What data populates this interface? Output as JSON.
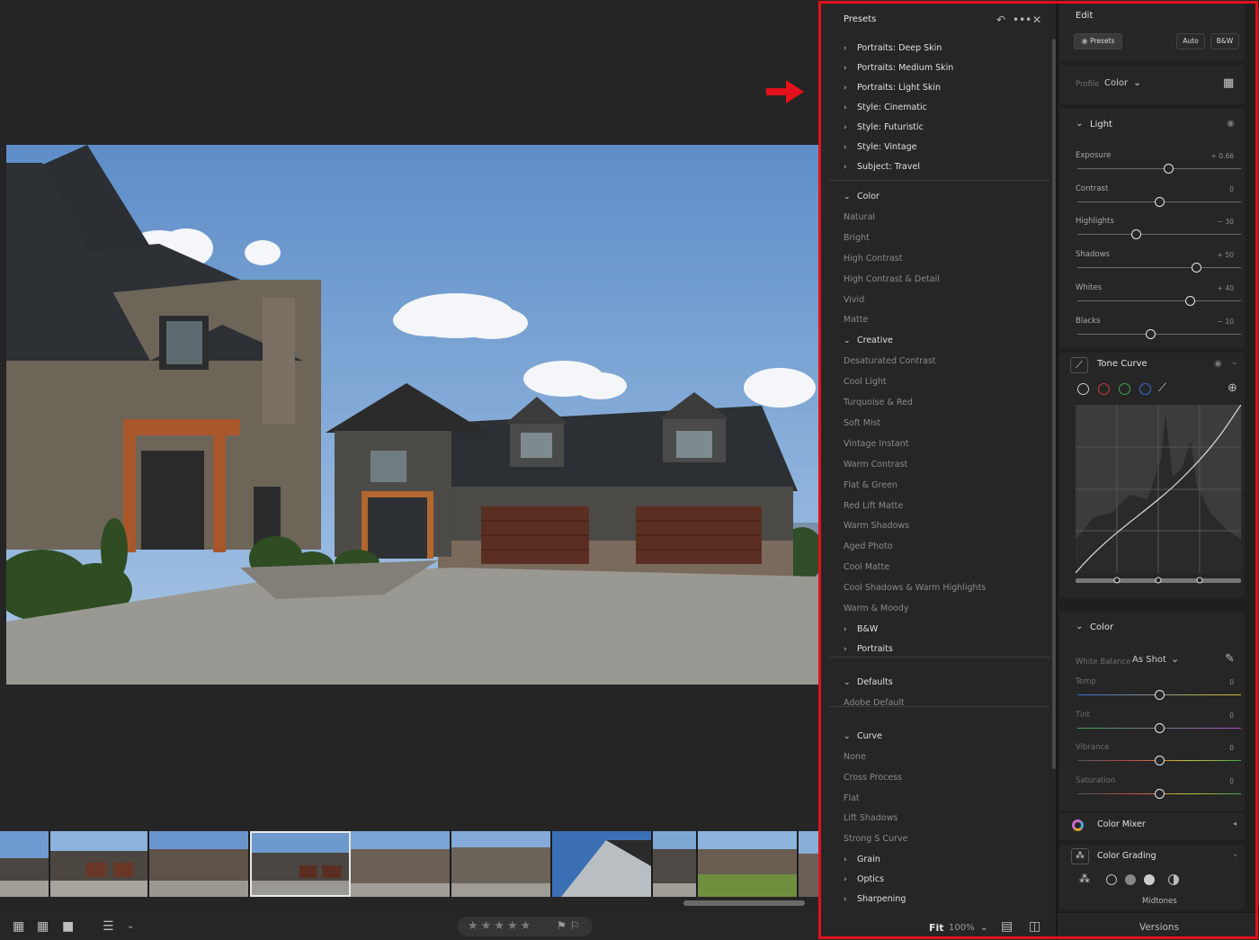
{
  "presets": {
    "title": "Presets",
    "groups_top": [
      {
        "label": "Portraits: Deep Skin"
      },
      {
        "label": "Portraits: Medium Skin"
      },
      {
        "label": "Portraits: Light Skin"
      },
      {
        "label": "Style: Cinematic"
      },
      {
        "label": "Style: Futuristic"
      },
      {
        "label": "Style: Vintage"
      },
      {
        "label": "Subject: Travel"
      }
    ],
    "color_group": {
      "label": "Color",
      "items": [
        "Natural",
        "Bright",
        "High Contrast",
        "High Contrast & Detail",
        "Vivid",
        "Matte"
      ]
    },
    "creative_group": {
      "label": "Creative",
      "items": [
        "Desaturated Contrast",
        "Cool Light",
        "Turquoise & Red",
        "Soft Mist",
        "Vintage Instant",
        "Warm Contrast",
        "Flat & Green",
        "Red Lift Matte",
        "Warm Shadows",
        "Aged Photo",
        "Cool Matte",
        "Cool Shadows & Warm Highlights",
        "Warm & Moody"
      ]
    },
    "bw_group": {
      "label": "B&W"
    },
    "portraits_group": {
      "label": "Portraits"
    },
    "defaults_group": {
      "label": "Defaults",
      "items": [
        "Adobe Default"
      ]
    },
    "curve_group": {
      "label": "Curve",
      "items": [
        "None",
        "Cross Process",
        "Flat",
        "Lift Shadows",
        "Strong S Curve"
      ]
    },
    "grain_group": {
      "label": "Grain"
    },
    "optics_group": {
      "label": "Optics"
    },
    "sharpening_group": {
      "label": "Sharpening"
    },
    "footer": {
      "fit": "Fit",
      "zoom": "100%"
    }
  },
  "edit": {
    "title": "Edit",
    "presets_button": "Presets",
    "auto_button": "Auto",
    "bw_button": "B&W",
    "profile_label": "Profile",
    "profile_value": "Color",
    "light": {
      "label": "Light",
      "sliders": [
        {
          "name": "Exposure",
          "value": "+ 0.66",
          "level": 0.56
        },
        {
          "name": "Contrast",
          "value": "0",
          "level": 0.5
        },
        {
          "name": "Highlights",
          "value": "− 30",
          "level": 0.36
        },
        {
          "name": "Shadows",
          "value": "+ 50",
          "level": 0.73
        },
        {
          "name": "Whites",
          "value": "+ 40",
          "level": 0.69
        },
        {
          "name": "Blacks",
          "value": "− 10",
          "level": 0.45
        }
      ]
    },
    "tone_curve": {
      "label": "Tone Curve"
    },
    "color": {
      "label": "Color",
      "wb_label": "White Balance",
      "wb_value": "As Shot",
      "sliders": [
        {
          "name": "Temp",
          "value": "0",
          "level": 0.5
        },
        {
          "name": "Tint",
          "value": "0",
          "level": 0.5
        },
        {
          "name": "Vibrance",
          "value": "0",
          "level": 0.5
        },
        {
          "name": "Saturation",
          "value": "0",
          "level": 0.5
        }
      ]
    },
    "color_mixer": {
      "label": "Color Mixer"
    },
    "color_grading": {
      "label": "Color Grading",
      "sub_label": "Midtones"
    },
    "versions": "Versions"
  },
  "colors": {
    "accent_frame": "#e3111c",
    "arrow": "#e3111c",
    "panel": "#262626"
  }
}
